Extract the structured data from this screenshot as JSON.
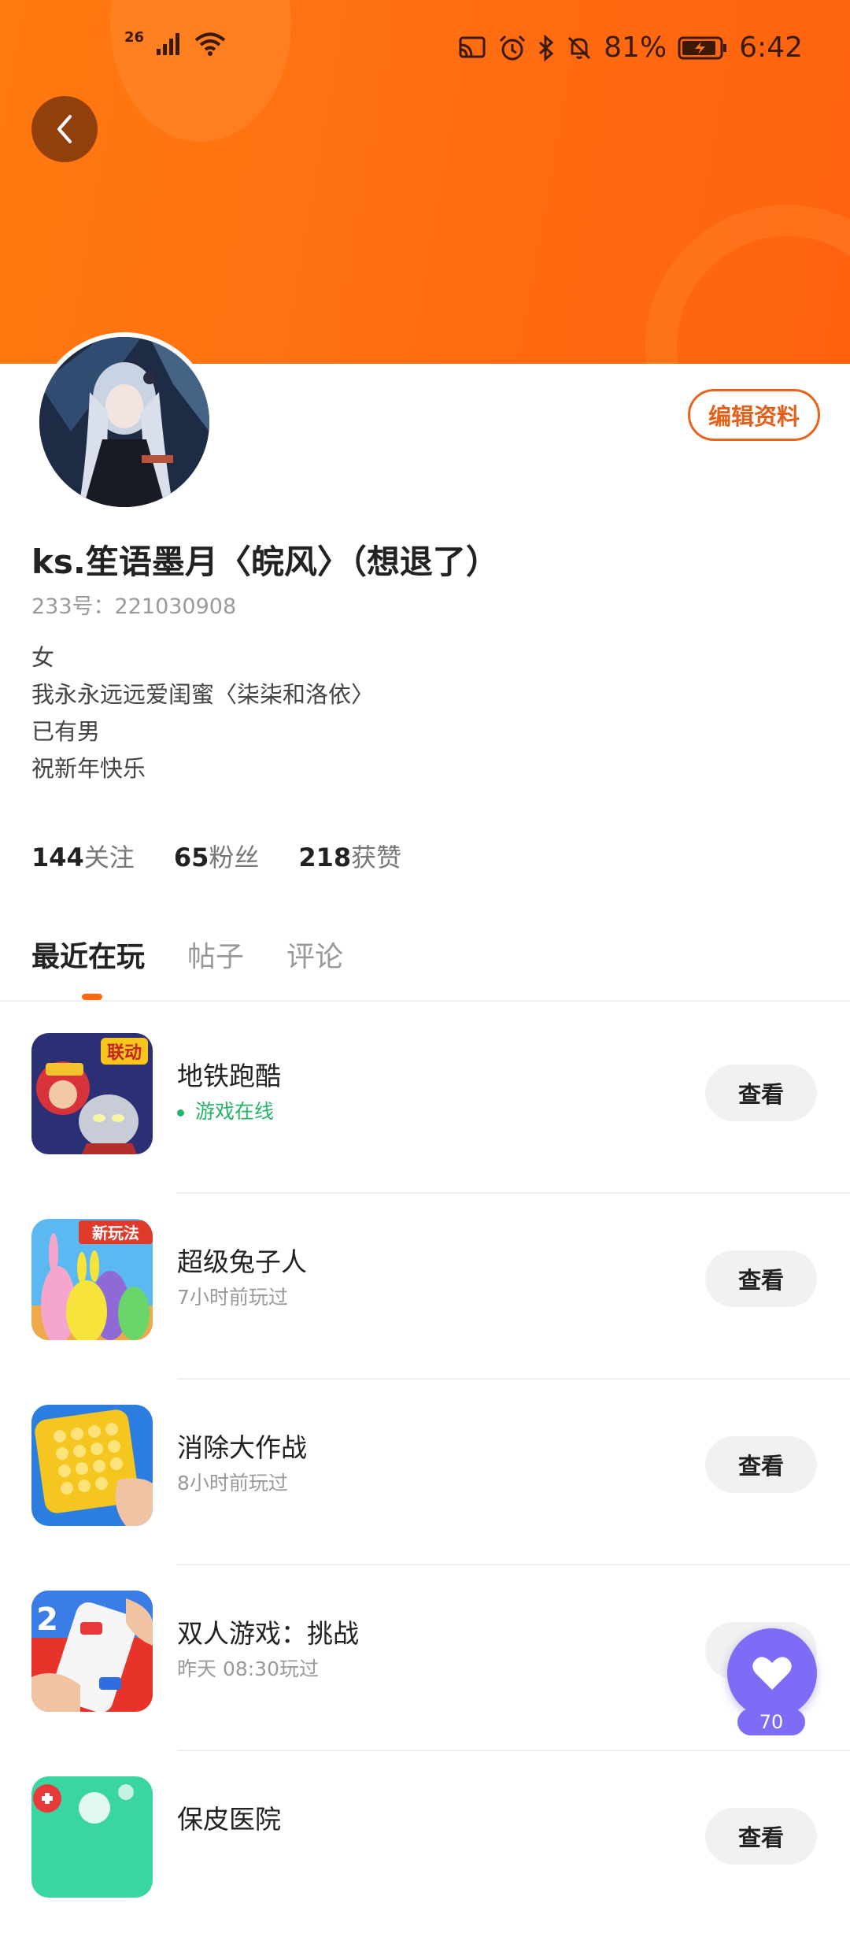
{
  "status_bar": {
    "network": "26",
    "battery_percent": "81%",
    "time": "6:42"
  },
  "profile": {
    "edit_label": "编辑资料",
    "username": "ks.笙语墨月〈皖风〉（想退了）",
    "uid": "233号：221030908",
    "bio": [
      "女",
      "我永永远远爱闺蜜〈柒柒和洛依〉",
      "已有男",
      "祝新年快乐"
    ]
  },
  "stats": [
    {
      "value": "144",
      "label": "关注"
    },
    {
      "value": "65",
      "label": "粉丝"
    },
    {
      "value": "218",
      "label": "获赞"
    }
  ],
  "tabs": [
    {
      "label": "最近在玩",
      "active": true
    },
    {
      "label": "帖子",
      "active": false
    },
    {
      "label": "评论",
      "active": false
    }
  ],
  "games": [
    {
      "title": "地铁跑酷",
      "status": "游戏在线",
      "online": true,
      "action": "查看",
      "icon": "subway-surfers-icon"
    },
    {
      "title": "超级兔子人",
      "status": "7小时前玩过",
      "online": false,
      "action": "查看",
      "icon": "super-bunny-man-icon"
    },
    {
      "title": "消除大作战",
      "status": "8小时前玩过",
      "online": false,
      "action": "查看",
      "icon": "pop-it-icon"
    },
    {
      "title": "双人游戏：挑战",
      "status": "昨天 08:30玩过",
      "online": false,
      "action": "查看",
      "icon": "two-player-games-icon"
    },
    {
      "title": "保皮医院",
      "status": "",
      "online": false,
      "action": "查看",
      "icon": "hospital-game-icon"
    }
  ],
  "icon_badges": {
    "game1": "联动",
    "game2": "新玩法",
    "game4": "2"
  },
  "floating": {
    "count": "70",
    "icon": "heart-icon"
  },
  "colors": {
    "header": "#ff6f12",
    "accent": "#e2601a",
    "online": "#27b36a",
    "fav": "#7d6cf5"
  }
}
